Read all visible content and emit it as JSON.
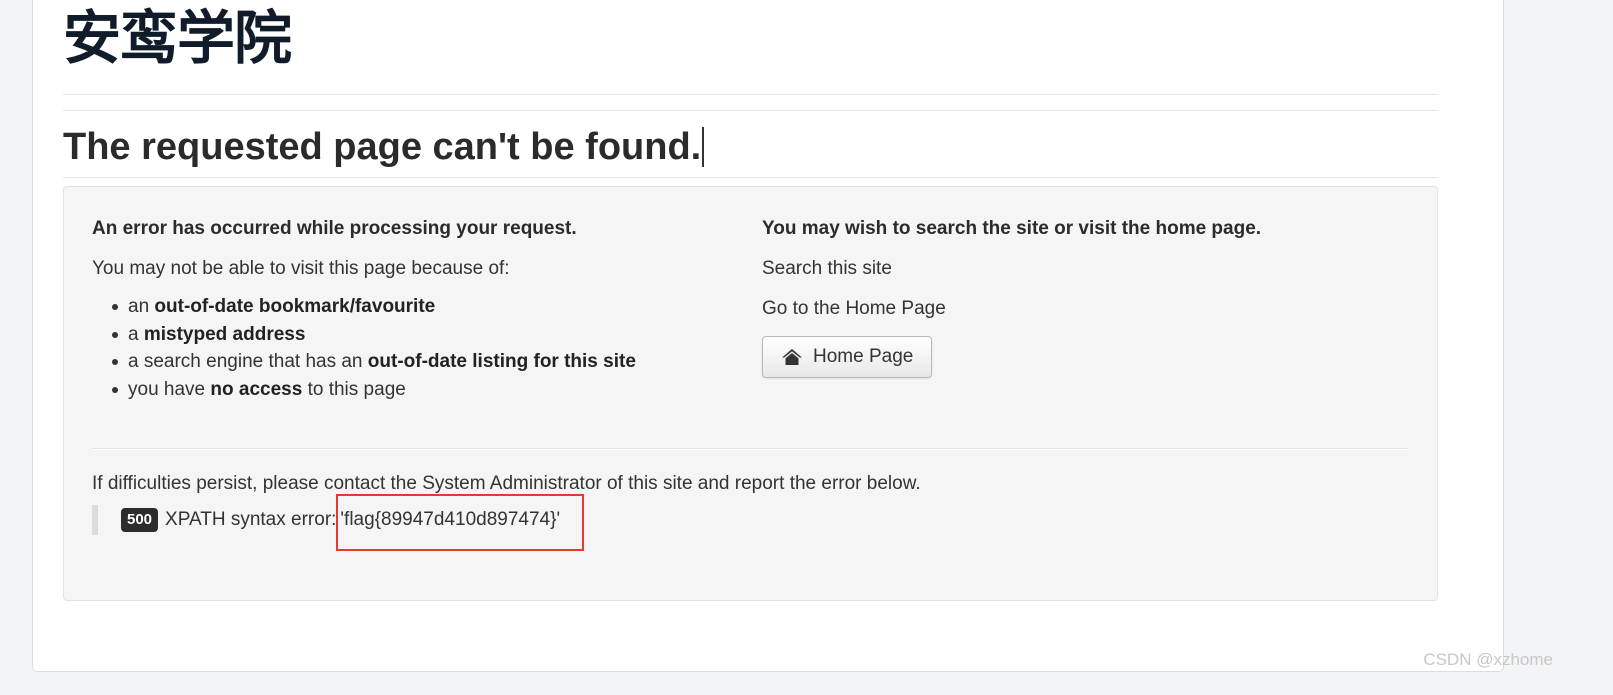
{
  "site": {
    "title": "安鸾学院"
  },
  "main": {
    "heading": "The requested page can't be found."
  },
  "error_panel": {
    "left": {
      "lead": "An error has occurred while processing your request.",
      "intro": "You may not be able to visit this page because of:",
      "reasons": [
        {
          "pre": "an ",
          "bold": "out-of-date bookmark/favourite",
          "post": ""
        },
        {
          "pre": "a ",
          "bold": "mistyped address",
          "post": ""
        },
        {
          "pre": "a search engine that has an ",
          "bold": "out-of-date listing for this site",
          "post": ""
        },
        {
          "pre": "you have ",
          "bold": "no access",
          "post": " to this page"
        }
      ]
    },
    "right": {
      "lead": "You may wish to search the site or visit the home page.",
      "search_link": "Search this site",
      "home_link": "Go to the Home Page",
      "home_button_label": "Home Page",
      "home_button_icon": "home-icon"
    },
    "persist_text": "If difficulties persist, please contact the System Administrator of this site and report the error below.",
    "error": {
      "code": "500",
      "label": "XPATH syntax error:",
      "message": "'flag{89947d410d897474}'"
    }
  },
  "colors": {
    "title": "#111c2a",
    "badge_bg": "#2c2c2c",
    "highlight_box": "#e53935",
    "well_bg": "#f5f5f5"
  },
  "watermark": "CSDN @xzhome"
}
